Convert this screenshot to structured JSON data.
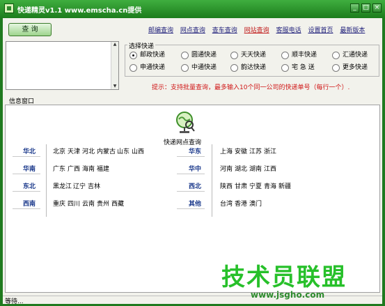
{
  "window": {
    "title": "快递精灵v1.1 www.emscha.cn提供",
    "controls": [
      "_",
      "□",
      "×"
    ]
  },
  "toolbar": {
    "query_label": "查 询",
    "links": [
      "邮编查询",
      "网点查询",
      "查车查询",
      "网站查询",
      "客服电话",
      "设置首页",
      "最新版本"
    ],
    "active_link_index": 3
  },
  "carrier_group": {
    "legend": "选择快递",
    "options": [
      "邮政快递",
      "圆通快递",
      "天天快递",
      "顺丰快递",
      "汇通快递",
      "申通快递",
      "中通快递",
      "韵达快递",
      "宅 急 送",
      "更多快递"
    ],
    "selected_index": 0
  },
  "tip": "提示：支持批量查询，最多输入10个同一公司的快递单号（每行一个）.",
  "info_window": {
    "label": "信息窗口",
    "center_title": "快递网点查询",
    "regions": [
      {
        "name": "华北",
        "cities": [
          "北京",
          "天津",
          "河北",
          "内蒙古",
          "山东",
          "山西"
        ]
      },
      {
        "name": "华东",
        "cities": [
          "上海",
          "安徽",
          "江苏",
          "浙江"
        ]
      },
      {
        "name": "华南",
        "cities": [
          "广东",
          "广西",
          "海南",
          "福建"
        ]
      },
      {
        "name": "华中",
        "cities": [
          "河南",
          "湖北",
          "湖南",
          "江西"
        ]
      },
      {
        "name": "东北",
        "cities": [
          "黑龙江",
          "辽宁",
          "吉林"
        ]
      },
      {
        "name": "西北",
        "cities": [
          "陕西",
          "甘肃",
          "宁夏",
          "青海",
          "新疆"
        ]
      },
      {
        "name": "西南",
        "cities": [
          "重庆",
          "四川",
          "云南",
          "贵州",
          "西藏"
        ]
      },
      {
        "name": "其他",
        "cities": [
          "台湾",
          "香港",
          "澳门"
        ]
      }
    ]
  },
  "status": {
    "text": "等待..."
  },
  "watermark": {
    "text": "技术员联盟",
    "sub": "www.jsgho.com"
  },
  "colors": {
    "accent": "#2e8b2e",
    "tip": "#d01616",
    "region_label": "#1c3a8c"
  }
}
